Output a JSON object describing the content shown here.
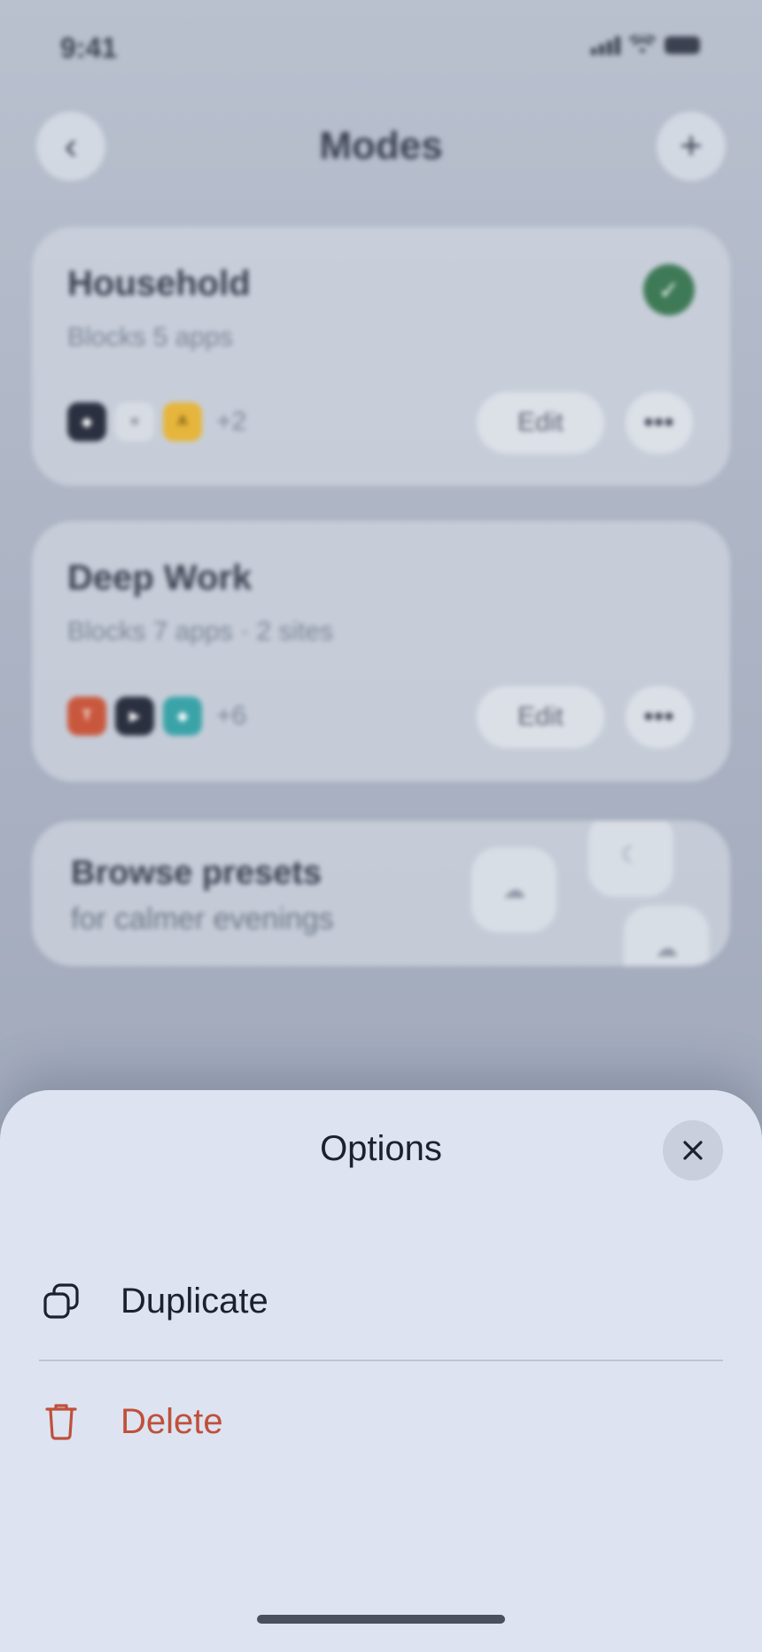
{
  "status_bar": {
    "time": "9:41"
  },
  "header": {
    "title": "Modes",
    "back_glyph": "‹",
    "add_glyph": "+"
  },
  "modes": [
    {
      "name": "Household",
      "subtitle": "Blocks 5 apps",
      "active": true,
      "app_icons": [
        {
          "letter": "◆",
          "color": "#2b3040"
        },
        {
          "letter": "■",
          "color": "#d7dbe3"
        },
        {
          "letter": "A",
          "color": "#e6b53b"
        }
      ],
      "extra": "+2",
      "edit_label": "Edit",
      "more_label": "•••"
    },
    {
      "name": "Deep Work",
      "subtitle": "Blocks 7 apps · 2 sites",
      "active": false,
      "app_icons": [
        {
          "letter": "T",
          "color": "#c9573d"
        },
        {
          "letter": "▶",
          "color": "#2b3040"
        },
        {
          "letter": "◆",
          "color": "#3aa3a8"
        }
      ],
      "extra": "+6",
      "edit_label": "Edit",
      "more_label": "•••"
    }
  ],
  "presets": {
    "title": "Browse presets",
    "subtitle": "for calmer evenings"
  },
  "sheet": {
    "title": "Options",
    "options": [
      {
        "label": "Duplicate",
        "icon": "duplicate-icon",
        "color": "#1c2130"
      },
      {
        "label": "Delete",
        "icon": "trash-icon",
        "color": "#c0503a"
      }
    ]
  },
  "colors": {
    "accent_green": "#3f7a57",
    "danger": "#c0503a",
    "sheet_bg": "#dde3f1"
  }
}
